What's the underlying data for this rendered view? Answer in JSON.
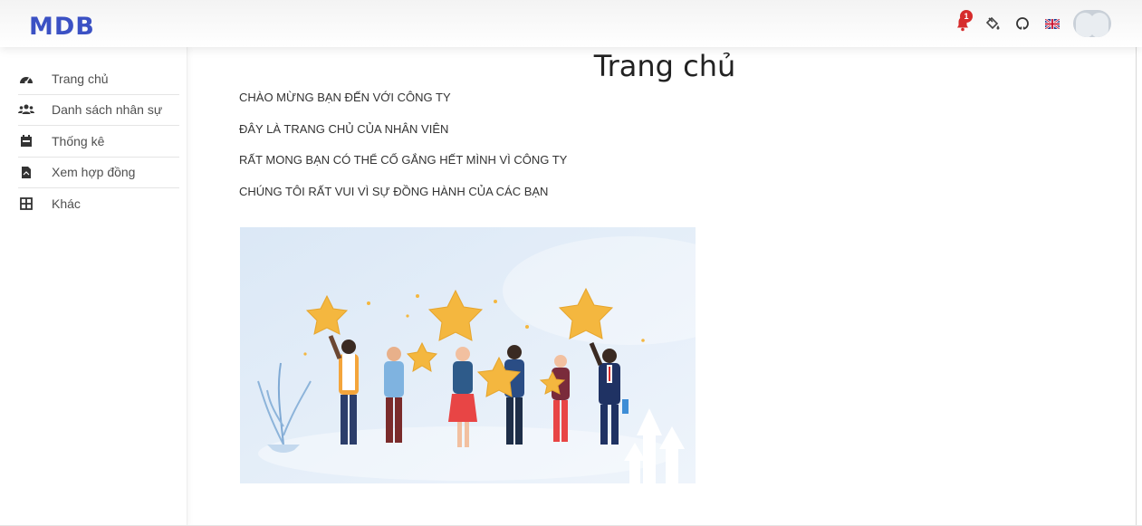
{
  "app": {
    "brand": "MDB"
  },
  "topbar": {
    "notification_count": "1",
    "icons": [
      "bell-icon",
      "paint-bucket-icon",
      "github-icon",
      "uk-flag-icon",
      "avatar"
    ]
  },
  "sidebar": {
    "items": [
      {
        "label": "Trang chủ",
        "icon": "dashboard-icon"
      },
      {
        "label": "Danh sách nhân sự",
        "icon": "users-icon"
      },
      {
        "label": "Thống kê",
        "icon": "calendar-icon"
      },
      {
        "label": "Xem hợp đồng",
        "icon": "file-icon"
      },
      {
        "label": "Khác",
        "icon": "grid-icon"
      }
    ]
  },
  "main": {
    "title": "Trang chủ",
    "lines": [
      "CHÀO MỪNG BẠN ĐẾN VỚI CÔNG TY",
      "ĐÂY LÀ TRANG CHỦ CỦA NHÂN VIÊN",
      "RẤT MONG BẠN CÓ THỂ CỐ GẮNG HẾT MÌNH VÌ CÔNG TY",
      "CHÚNG TÔI RẤT VUI VÌ SỰ ĐỒNG HÀNH CỦA CÁC BẠN"
    ]
  },
  "colors": {
    "brand_m": "#3b51c4",
    "brand_d": "#2d58b5",
    "brand_b": "#6a2d8f",
    "badge": "#d62b2b",
    "star": "#f4b73f",
    "hero_bg": "#e4eef8"
  }
}
